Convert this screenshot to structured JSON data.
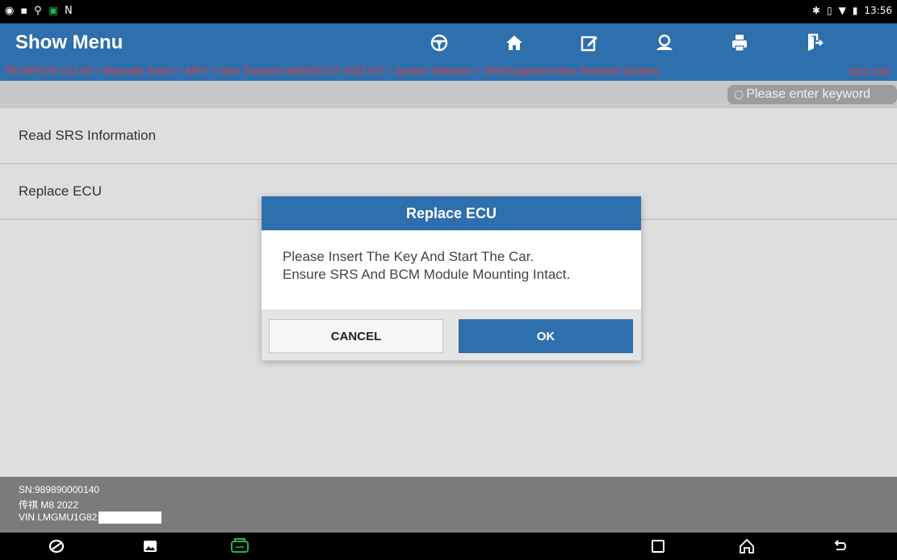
{
  "status_bar": {
    "left_icons": [
      "app-icon",
      "image-icon",
      "usb-icon",
      "vpn-icon",
      "n-icon"
    ],
    "time": "13:56"
  },
  "header": {
    "title": "Show Menu",
    "toolbar": [
      "steering-wheel-icon",
      "home-icon",
      "edit-report-icon",
      "user-icon",
      "print-icon",
      "exit-icon"
    ]
  },
  "breadcrumb": {
    "path": "TRUMPCHI V12.30 > Manually Select > MPV > New Trumpchi M8(2020.07-2022.07) > System Selection > SRS(Supplementary Restraint System)",
    "voltage": "12.19V"
  },
  "search": {
    "placeholder": "Please enter keyword"
  },
  "menu": {
    "items": [
      {
        "label": "Read SRS Information"
      },
      {
        "label": "Replace ECU"
      }
    ]
  },
  "dialog": {
    "title": "Replace ECU",
    "line1": "Please Insert The Key And Start The Car.",
    "line2": "Ensure SRS And BCM Module Mounting Intact.",
    "cancel_label": "CANCEL",
    "ok_label": "OK"
  },
  "footer": {
    "sn": "SN:989890000140",
    "model": "传祺 M8 2022",
    "vin": "VIN LMGMU1G82"
  },
  "colors": {
    "primary": "#2e6fad",
    "breadcrumb_text": "#e23b3b",
    "vci_green": "#2bb34a"
  }
}
